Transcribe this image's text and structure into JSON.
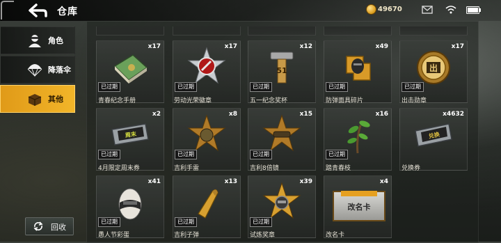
{
  "header": {
    "title": "仓库",
    "currency": "49670"
  },
  "sidebar": {
    "items": [
      {
        "label": "角色",
        "icon": "character-icon",
        "active": false
      },
      {
        "label": "降落伞",
        "icon": "parachute-icon",
        "active": false
      },
      {
        "label": "其他",
        "icon": "crate-icon",
        "active": true
      }
    ],
    "recycle_label": "回收"
  },
  "colors": {
    "accent": "#f2b529",
    "panel": "#2a2d2a"
  },
  "inventory": {
    "expired_label": "已过期",
    "items": [
      {
        "name": "青春纪念手册",
        "qty": "x17",
        "expired": true,
        "icon": "notebook-icon"
      },
      {
        "name": "劳动光荣徽章",
        "qty": "x17",
        "expired": true,
        "icon": "badge-icon"
      },
      {
        "name": "五一纪念奖杯",
        "qty": "x12",
        "expired": true,
        "icon": "hammer-trophy-icon"
      },
      {
        "name": "防弹面具碎片",
        "qty": "x49",
        "expired": true,
        "icon": "mask-fragment-icon"
      },
      {
        "name": "出击勋章",
        "qty": "x17",
        "expired": true,
        "icon": "medal-icon"
      },
      {
        "name": "4月限定周末券",
        "qty": "x2",
        "expired": true,
        "icon": "ticket-icon"
      },
      {
        "name": "吉利手雷",
        "qty": "x8",
        "expired": true,
        "icon": "grenade-star-icon"
      },
      {
        "name": "吉利8倍镜",
        "qty": "x15",
        "expired": true,
        "icon": "scope-star-icon"
      },
      {
        "name": "踏青春枝",
        "qty": "x16",
        "expired": true,
        "icon": "sprout-icon"
      },
      {
        "name": "兑换券",
        "qty": "x4632",
        "expired": false,
        "icon": "voucher-icon"
      },
      {
        "name": "愚人节彩蛋",
        "qty": "x41",
        "expired": true,
        "icon": "egg-icon"
      },
      {
        "name": "吉利子弹",
        "qty": "x13",
        "expired": true,
        "icon": "bullet-icon"
      },
      {
        "name": "试炼奖章",
        "qty": "x39",
        "expired": true,
        "icon": "trial-medal-icon"
      },
      {
        "name": "改名卡",
        "qty": "x4",
        "expired": false,
        "icon": "rename-card-icon",
        "card_text": "改名卡"
      }
    ]
  }
}
